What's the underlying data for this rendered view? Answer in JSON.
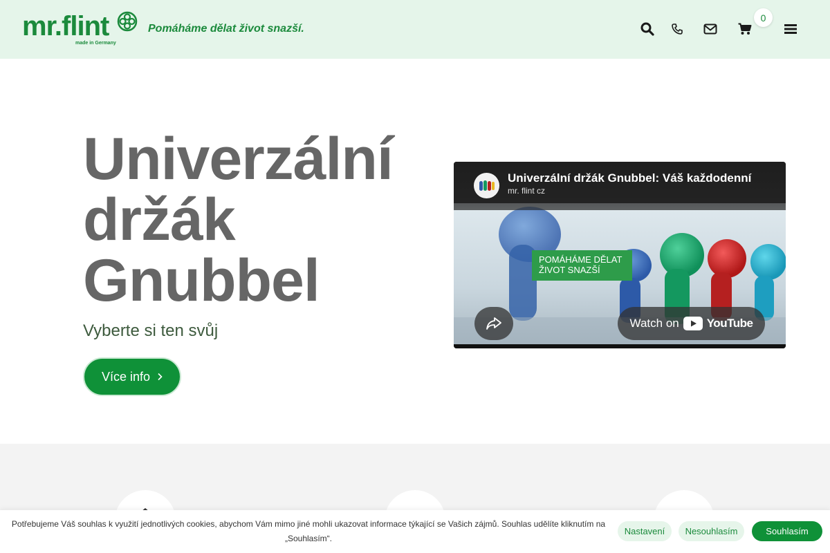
{
  "header": {
    "logo_text": "mr.flint",
    "logo_sub": "made in Germany",
    "tagline": "Pomáháme dělat život snazší.",
    "icons": [
      "search-icon",
      "phone-icon",
      "mail-icon",
      "cart-icon",
      "menu-icon"
    ],
    "cart_count": "0"
  },
  "hero": {
    "title_line1": "Univerzální",
    "title_line2": "držák",
    "title_line3": "Gnubbel",
    "subtitle": "Vyberte si ten svůj",
    "button_label": "Více info",
    "button_icon": "chevron-right-icon"
  },
  "video": {
    "title": "Univerzální držák Gnubbel: Váš každodenní",
    "channel": "mr. flint cz",
    "overlay_text": "POMÁHÁME DĚLAT ŽIVOT SNAZŠÍ",
    "watch_label": "Watch on",
    "youtube_label": "YouTube"
  },
  "cookie": {
    "text": "Potřebujeme Váš souhlas k využití jednotlivých cookies, abychom Vám mimo jiné mohli ukazovat informace týkající se Vašich zájmů. Souhlas udělíte kliknutím na „Souhlasím“.",
    "settings_label": "Nastavení",
    "decline_label": "Nesouhlasím",
    "accept_label": "Souhlasím"
  },
  "colors": {
    "brand_green": "#1b8a3c",
    "button_green": "#0f9138",
    "header_bg": "#e5f5ea",
    "title_gray": "#666666"
  }
}
